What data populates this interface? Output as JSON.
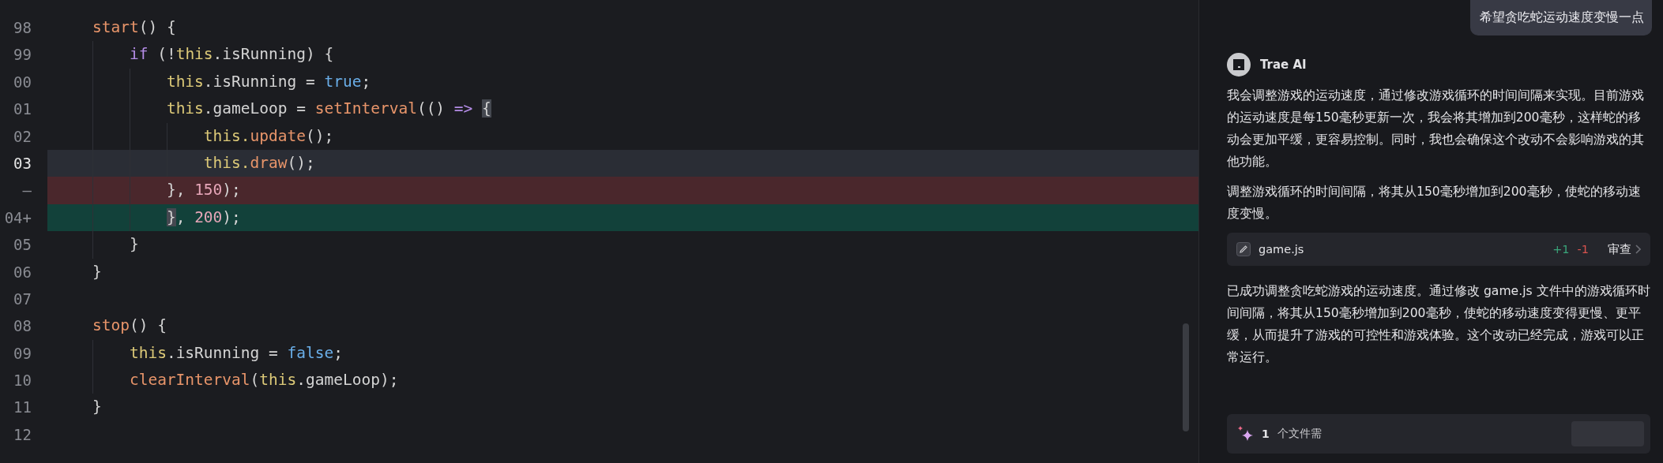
{
  "editor": {
    "lines": [
      {
        "number": "98",
        "kind": "normal",
        "tokens": [
          {
            "t": "    start",
            "kind": "fn"
          },
          {
            "t": "() {",
            "kind": "plain"
          }
        ]
      },
      {
        "number": "99",
        "kind": "normal",
        "tokens": [
          {
            "t": "        if",
            "kind": "kw"
          },
          {
            "t": " (!",
            "kind": "plain"
          },
          {
            "t": "this",
            "kind": "this"
          },
          {
            "t": ".isRunning) {",
            "kind": "plain"
          }
        ]
      },
      {
        "number": "00",
        "kind": "normal",
        "tokens": [
          {
            "t": "            this",
            "kind": "this"
          },
          {
            "t": ".isRunning = ",
            "kind": "plain"
          },
          {
            "t": "true",
            "kind": "lit"
          },
          {
            "t": ";",
            "kind": "plain"
          }
        ]
      },
      {
        "number": "01",
        "kind": "normal",
        "tokens": [
          {
            "t": "            this",
            "kind": "this"
          },
          {
            "t": ".gameLoop = ",
            "kind": "plain"
          },
          {
            "t": "setInterval",
            "kind": "fn"
          },
          {
            "t": "(() ",
            "kind": "plain"
          },
          {
            "t": "=> ",
            "kind": "kw"
          },
          {
            "t": "{",
            "kind": "match"
          }
        ]
      },
      {
        "number": "02",
        "kind": "normal",
        "tokens": [
          {
            "t": "                this.",
            "kind": "this"
          },
          {
            "t": "update",
            "kind": "fn"
          },
          {
            "t": "();",
            "kind": "plain"
          }
        ]
      },
      {
        "number": "03",
        "kind": "current",
        "tokens": [
          {
            "t": "                this.",
            "kind": "this"
          },
          {
            "t": "draw",
            "kind": "fn"
          },
          {
            "t": "();",
            "kind": "plain"
          }
        ]
      },
      {
        "number": "—",
        "kind": "deleted",
        "tokens": [
          {
            "t": "            }, ",
            "kind": "plain"
          },
          {
            "t": "150",
            "kind": "num"
          },
          {
            "t": ");",
            "kind": "plain"
          }
        ]
      },
      {
        "number": "04+",
        "kind": "added",
        "tokens": [
          {
            "t": "            }",
            "kind": "match"
          },
          {
            "t": ", ",
            "kind": "plain"
          },
          {
            "t": "200",
            "kind": "num"
          },
          {
            "t": ");",
            "kind": "plain"
          }
        ]
      },
      {
        "number": "05",
        "kind": "normal",
        "tokens": [
          {
            "t": "        }",
            "kind": "plain"
          }
        ]
      },
      {
        "number": "06",
        "kind": "normal",
        "tokens": [
          {
            "t": "    }",
            "kind": "plain"
          }
        ]
      },
      {
        "number": "07",
        "kind": "normal"
      },
      {
        "number": "08",
        "kind": "normal",
        "tokens": [
          {
            "t": "    stop",
            "kind": "fn"
          },
          {
            "t": "() {",
            "kind": "plain"
          }
        ]
      },
      {
        "number": "09",
        "kind": "normal",
        "tokens": [
          {
            "t": "        this",
            "kind": "this"
          },
          {
            "t": ".isRunning = ",
            "kind": "plain"
          },
          {
            "t": "false",
            "kind": "lit"
          },
          {
            "t": ";",
            "kind": "plain"
          }
        ]
      },
      {
        "number": "10",
        "kind": "normal",
        "tokens": [
          {
            "t": "        clearInterval",
            "kind": "fn"
          },
          {
            "t": "(",
            "kind": "plain"
          },
          {
            "t": "this",
            "kind": "this"
          },
          {
            "t": ".gameLoop);",
            "kind": "plain"
          }
        ]
      },
      {
        "number": "11",
        "kind": "normal",
        "tokens": [
          {
            "t": "    }",
            "kind": "plain"
          }
        ]
      },
      {
        "number": "12",
        "kind": "normal"
      }
    ]
  },
  "chat": {
    "user_message": "希望贪吃蛇运动速度变慢一点",
    "assistant": {
      "name": "Trae AI",
      "paragraphs_before": [
        "我会调整游戏的运动速度，通过修改游戏循环的时间间隔来实现。目前游戏的运动速度是每150毫秒更新一次，我会将其增加到200毫秒，这样蛇的移动会更加平缓，更容易控制。同时，我也会确保这个改动不会影响游戏的其他功能。",
        "调整游戏循环的时间间隔，将其从150毫秒增加到200毫秒，使蛇的移动速度变慢。"
      ],
      "file_card": {
        "filename": "game.js",
        "added": "+1",
        "removed": "-1",
        "action": "审查"
      },
      "paragraphs_after": [
        "已成功调整贪吃蛇游戏的运动速度。通过修改 game.js 文件中的游戏循环时间间隔，将其从150毫秒增加到200毫秒，使蛇的移动速度变得更慢、更平缓，从而提升了游戏的可控性和游戏体验。这个改动已经完成，游戏可以正常运行。"
      ]
    },
    "pending_bar": {
      "count": "1",
      "label": "个文件需"
    }
  }
}
